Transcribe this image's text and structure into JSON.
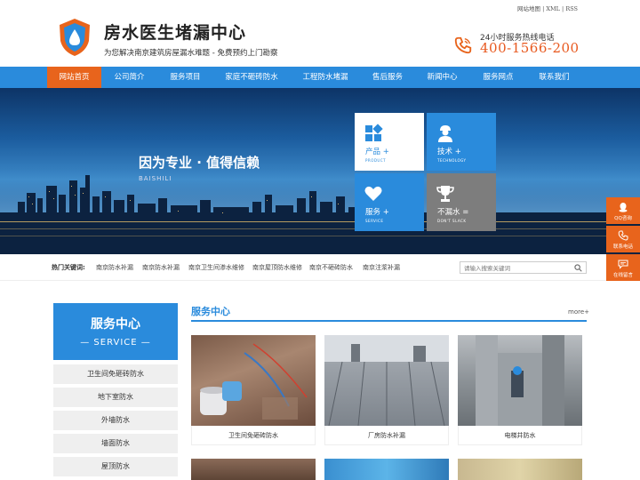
{
  "header": {
    "top_links": [
      "网站地图",
      "XML",
      "RSS"
    ],
    "title": "房水医生堵漏中心",
    "slogan": "为您解决南京建筑房屋漏水难题 - 免费预约上门勘察",
    "hotline_label": "24小时服务热线电话",
    "hotline_number": "400-1566-200"
  },
  "nav": {
    "items": [
      "网站首页",
      "公司简介",
      "服务项目",
      "家庭不砸砖防水",
      "工程防水堵漏",
      "售后服务",
      "新闻中心",
      "服务网点",
      "联系我们"
    ],
    "active_index": 0
  },
  "banner": {
    "slogan": "因为专业 · 值得信赖",
    "sub": "BAISHILI",
    "tiles": [
      {
        "label": "产品 +",
        "en": "PRODUCT",
        "icon": "grid-icon"
      },
      {
        "label": "技术 +",
        "en": "TECHNOLOGY",
        "icon": "worker-icon"
      },
      {
        "label": "服务 +",
        "en": "SERVICE",
        "icon": "heart-icon"
      },
      {
        "label": "不漏水 =",
        "en": "DON'T SLACK",
        "icon": "trophy-icon"
      }
    ]
  },
  "keywords": {
    "label": "热门关键词:",
    "items": [
      "南京防水补漏",
      "南京防水补漏",
      "南京卫生间渗水维修",
      "南京屋顶防水维修",
      "南京不砸砖防水",
      "南京注浆补漏"
    ]
  },
  "search": {
    "placeholder": "请输入搜索关键词"
  },
  "sidebar": {
    "title": "服务中心",
    "subtitle": "— SERVICE —",
    "items": [
      "卫生间免砸砖防水",
      "地下室防水",
      "外墙防水",
      "墙面防水",
      "屋顶防水"
    ]
  },
  "content": {
    "section_title": "服务中心",
    "more": "more+",
    "cards": [
      "卫生间免砸砖防水",
      "厂房防水补漏",
      "电梯井防水"
    ]
  },
  "float_buttons": [
    {
      "label": "QQ咨询",
      "icon": "qq-icon"
    },
    {
      "label": "联系电话",
      "icon": "phone-icon"
    },
    {
      "label": "在线留言",
      "icon": "chat-icon"
    }
  ],
  "colors": {
    "primary": "#2a8bdc",
    "accent": "#e8641c"
  }
}
